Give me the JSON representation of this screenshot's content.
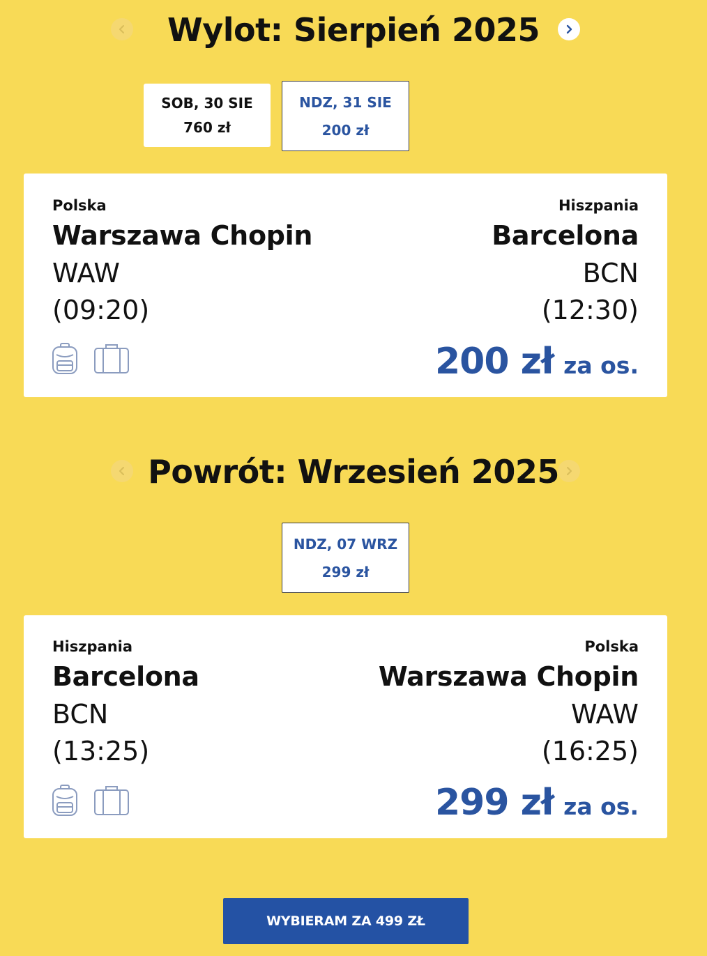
{
  "outbound": {
    "title": "Wylot: Sierpień 2025",
    "dates": [
      {
        "label": "SOB, 30 SIE",
        "price": "760 zł",
        "selected": false
      },
      {
        "label": "NDZ, 31 SIE",
        "price": "200 zł",
        "selected": true
      }
    ],
    "flight": {
      "from_country": "Polska",
      "from_city": "Warszawa Chopin",
      "from_code": "WAW",
      "from_time": "(09:20)",
      "to_country": "Hiszpania",
      "to_city": "Barcelona",
      "to_code": "BCN",
      "to_time": "(12:30)",
      "price": "200 zł",
      "per_person": "za os."
    }
  },
  "return": {
    "title": "Powrót: Wrzesień 2025",
    "dates": [
      {
        "label": "NDZ, 07 WRZ",
        "price": "299 zł",
        "selected": true
      }
    ],
    "flight": {
      "from_country": "Hiszpania",
      "from_city": "Barcelona",
      "from_code": "BCN",
      "from_time": "(13:25)",
      "to_country": "Polska",
      "to_city": "Warszawa Chopin",
      "to_code": "WAW",
      "to_time": "(16:25)",
      "price": "299 zł",
      "per_person": "za os."
    }
  },
  "cta": {
    "label": "WYBIERAM ZA 499 ZŁ"
  },
  "icons": {
    "prev": "chevron-left-icon",
    "next": "chevron-right-icon",
    "backpack": "backpack-icon",
    "suitcase": "suitcase-icon"
  },
  "colors": {
    "background": "#f8da56",
    "accent": "#2a54a0",
    "cta": "#2452a4"
  }
}
